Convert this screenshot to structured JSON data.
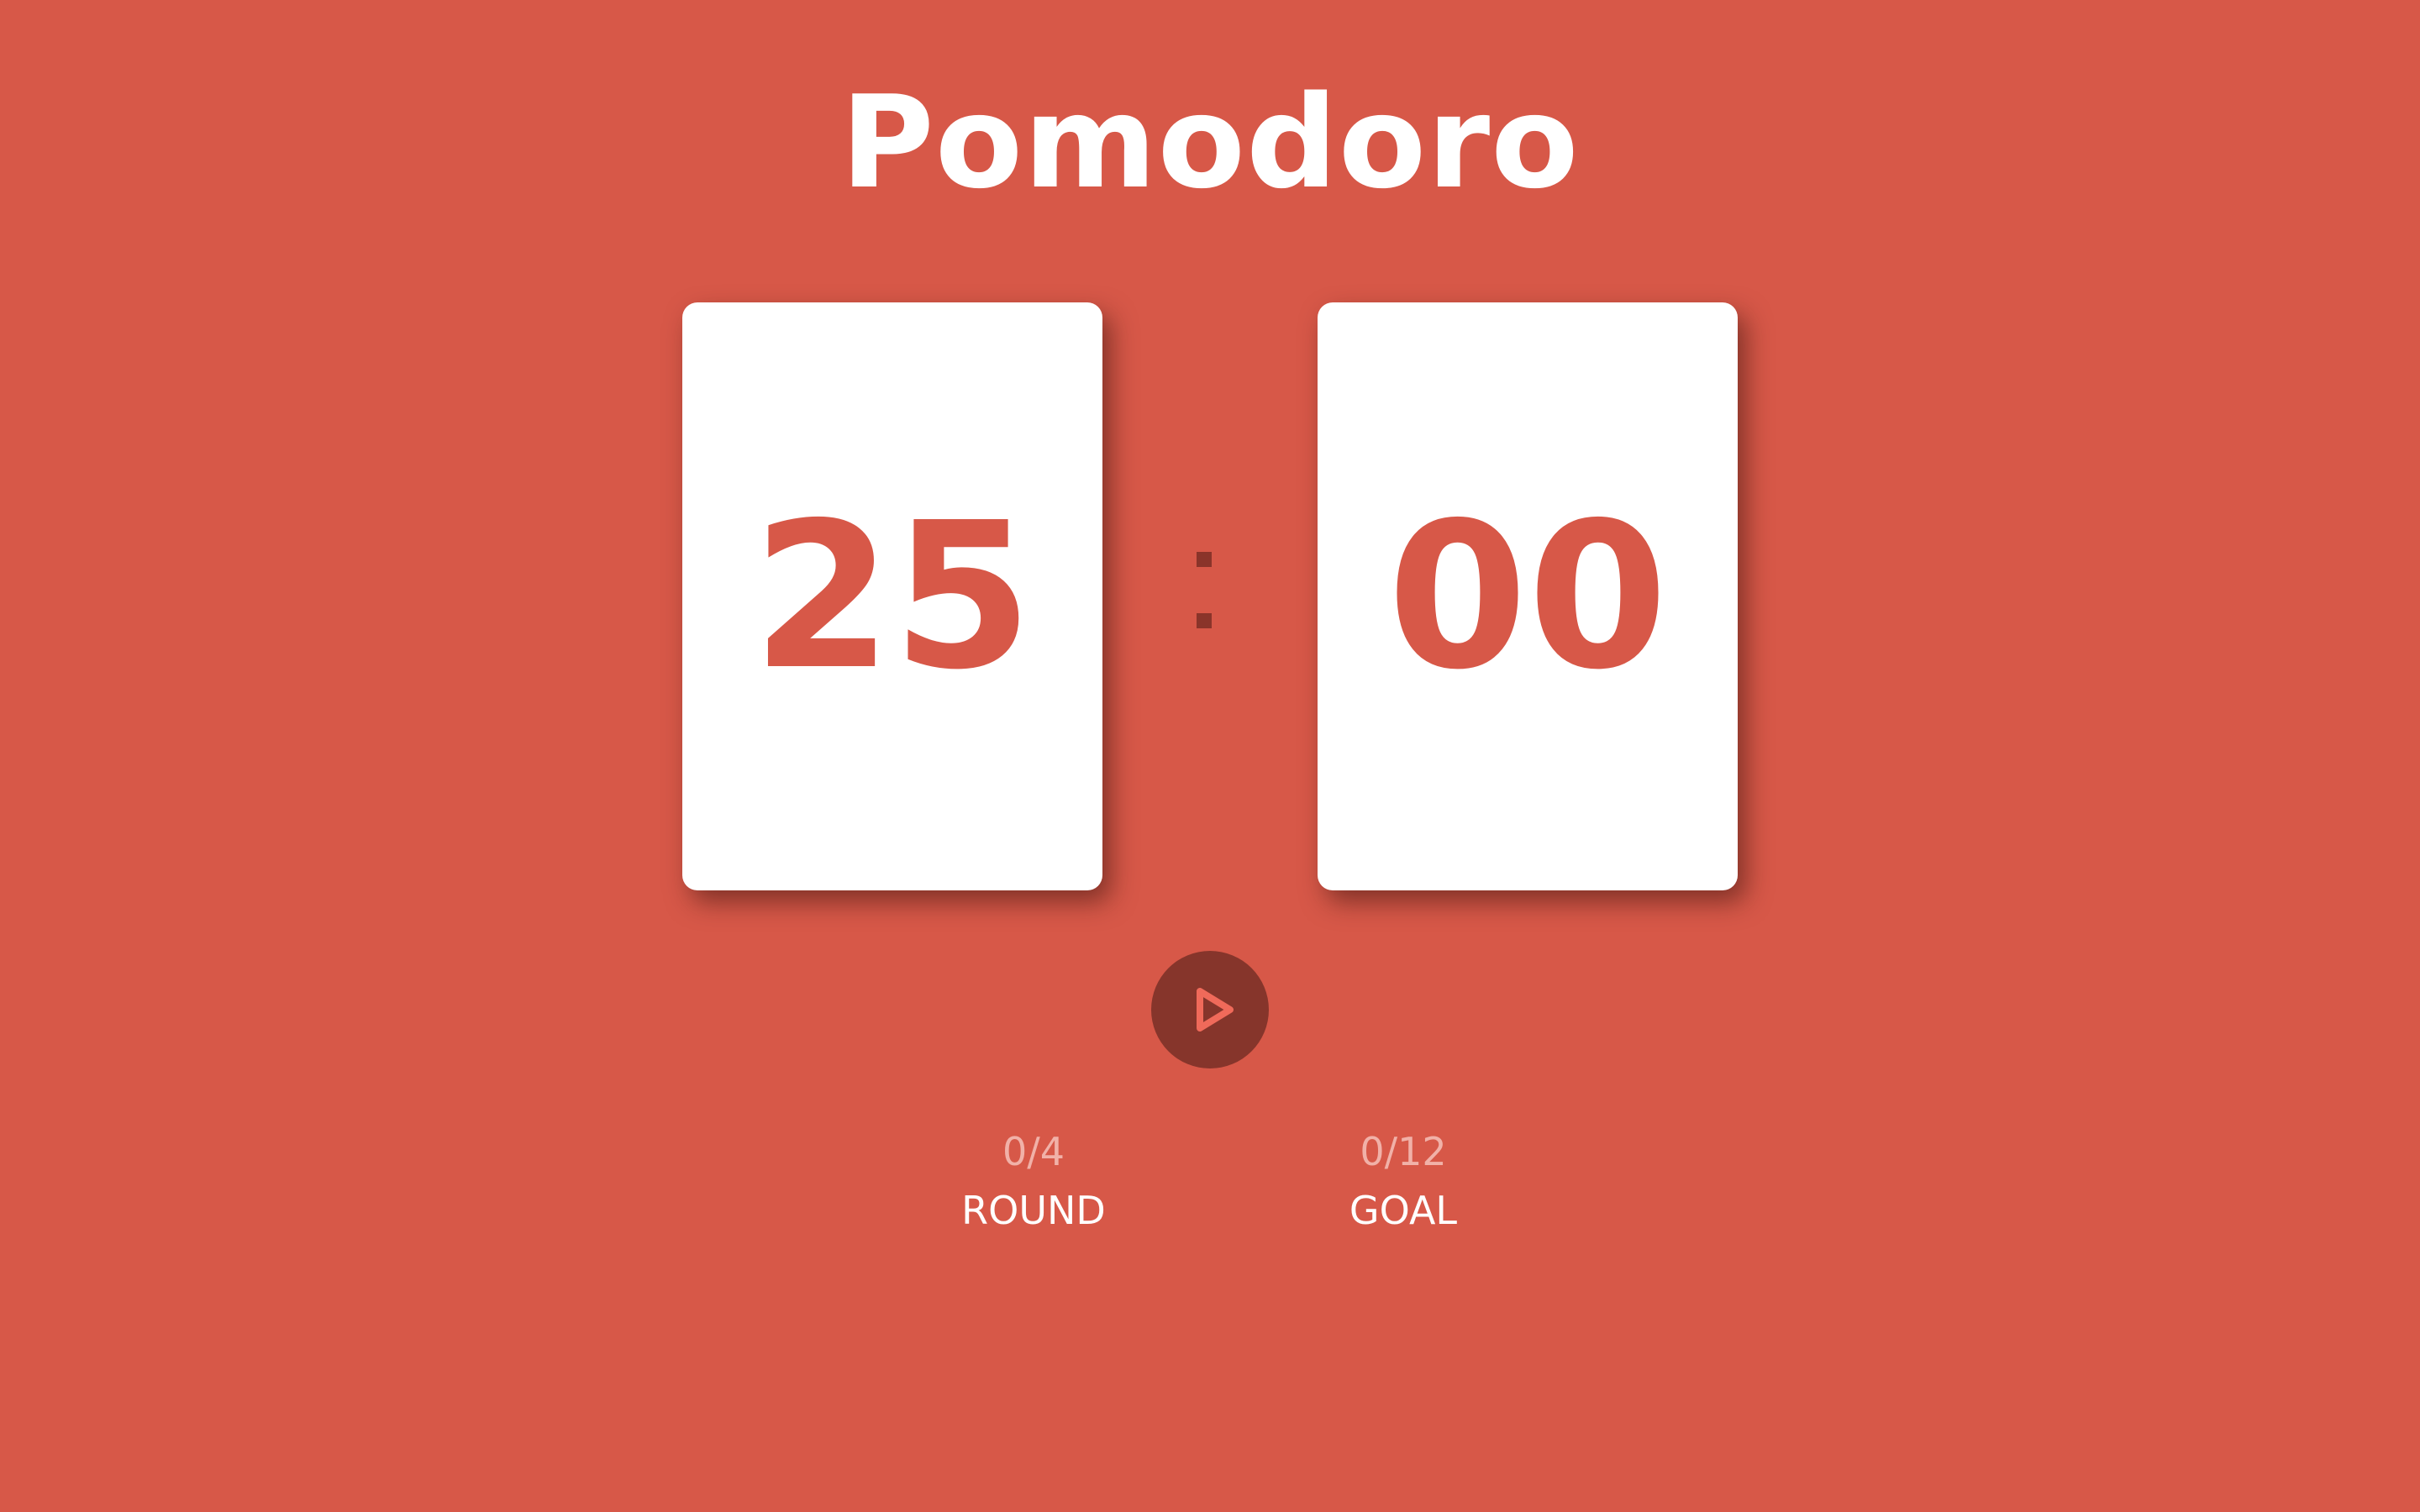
{
  "app": {
    "title": "Pomodoro"
  },
  "timer": {
    "minutes": "25",
    "seconds": "00",
    "separator_icon": "colon-separator"
  },
  "controls": {
    "play_icon": "play-icon"
  },
  "stats": {
    "round": {
      "value": "0/4",
      "label": "ROUND"
    },
    "goal": {
      "value": "0/12",
      "label": "GOAL"
    }
  },
  "colors": {
    "background": "#d75848",
    "card": "#ffffff",
    "digits": "#d75848",
    "button": "#86352b",
    "stat_value": "#f1b1a8"
  }
}
